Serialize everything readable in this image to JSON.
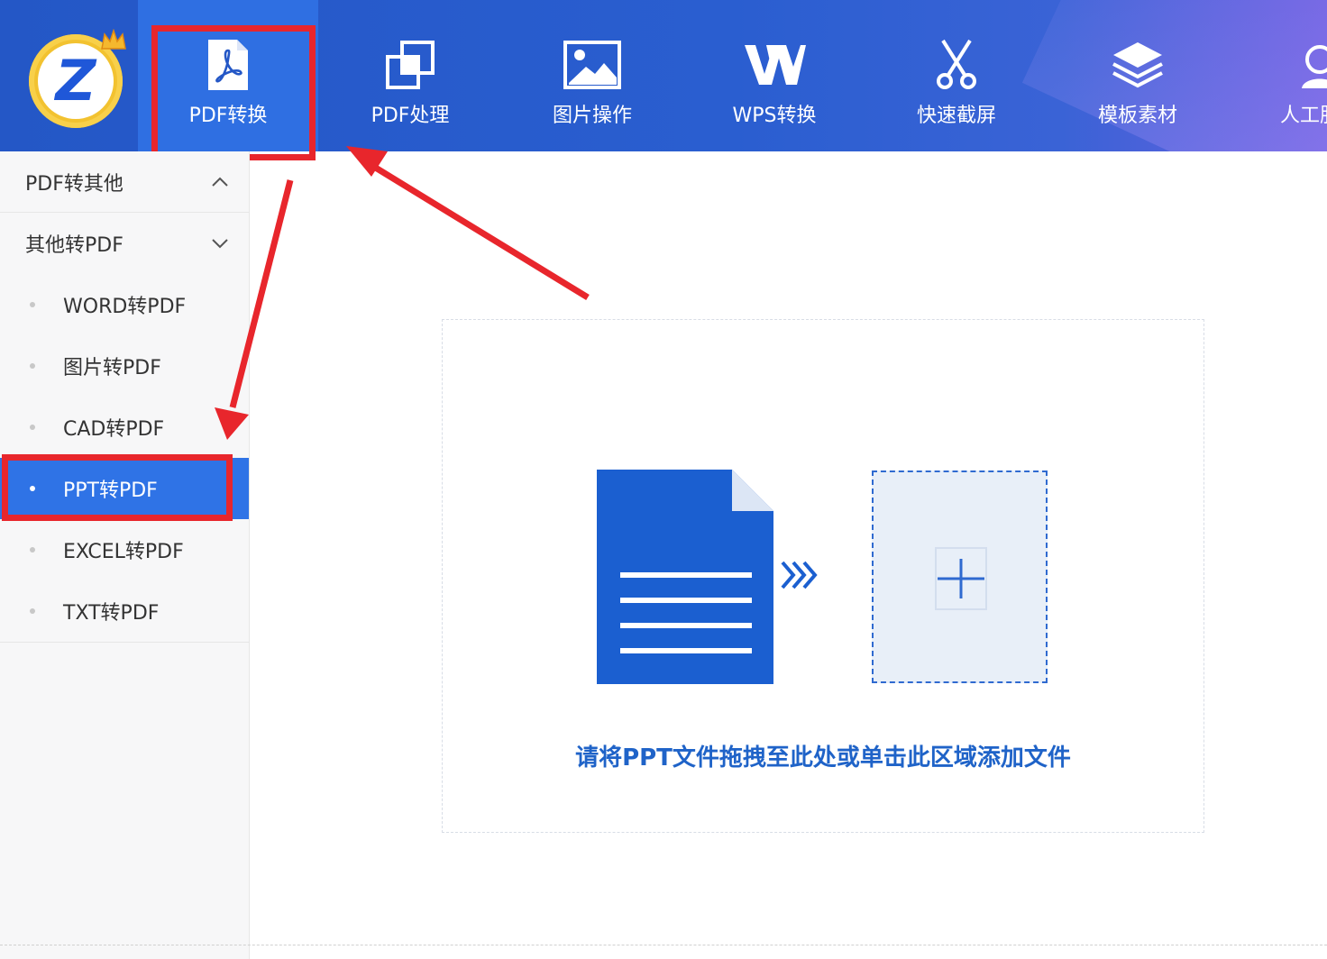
{
  "toolbar": {
    "items": [
      {
        "label": "PDF转换",
        "icon": "pdf-acrobat-icon"
      },
      {
        "label": "PDF处理",
        "icon": "pdf-process-icon"
      },
      {
        "label": "图片操作",
        "icon": "image-icon"
      },
      {
        "label": "WPS转换",
        "icon": "wps-icon"
      },
      {
        "label": "快速截屏",
        "icon": "scissors-icon"
      },
      {
        "label": "模板素材",
        "icon": "layers-icon"
      },
      {
        "label": "人工服务",
        "icon": "support-icon"
      }
    ],
    "active_index": 0
  },
  "sidebar": {
    "groups": [
      {
        "label": "PDF转其他",
        "icon": "chevron-up-icon"
      },
      {
        "label": "其他转PDF",
        "icon": "chevron-down-icon"
      }
    ],
    "items": [
      {
        "label": "WORD转PDF"
      },
      {
        "label": "图片转PDF"
      },
      {
        "label": "CAD转PDF"
      },
      {
        "label": "PPT转PDF"
      },
      {
        "label": "EXCEL转PDF"
      },
      {
        "label": "TXT转PDF"
      }
    ],
    "active_item_index": 3
  },
  "main": {
    "hint_text": "请将PPT文件拖拽至此处或单击此区域添加文件",
    "doc_icon": "document-icon",
    "arrow_icon": "chevrons-right-icon",
    "add_icon": "plus-icon"
  },
  "colors": {
    "toolbar_bg": "#2457c6",
    "active_blue": "#2f73e6",
    "annotation_red": "#e8262c",
    "hint_blue": "#1f63c8"
  }
}
